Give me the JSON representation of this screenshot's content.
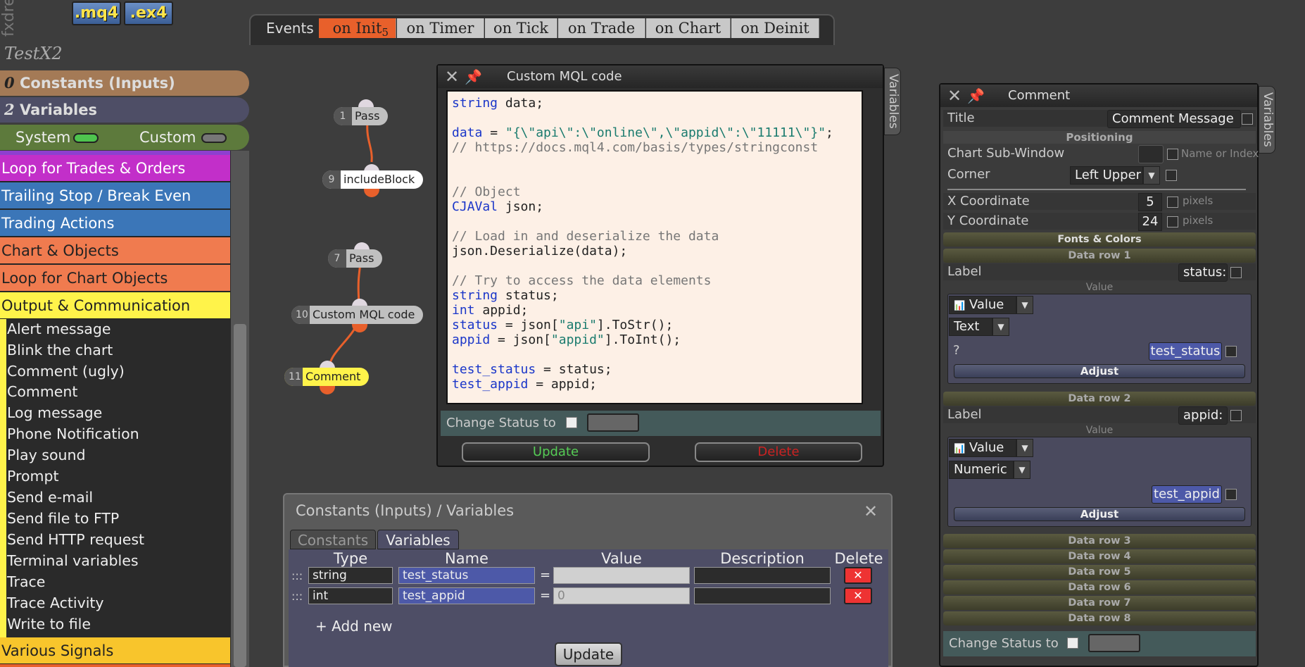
{
  "app": {
    "brand": "fxdre",
    "ext_mq4": ".mq4",
    "ext_ex4": ".ex4",
    "project_name": "TestX2"
  },
  "events": {
    "label": "Events",
    "tabs": [
      {
        "label": "on Init",
        "badge": "5",
        "active": true
      },
      {
        "label": "on Timer"
      },
      {
        "label": "on Tick"
      },
      {
        "label": "on Trade"
      },
      {
        "label": "on Chart"
      },
      {
        "label": "on Deinit"
      }
    ]
  },
  "sidebar": {
    "constants": {
      "count": "0",
      "label": "Constants (Inputs)"
    },
    "variables": {
      "count": "2",
      "label": "Variables"
    },
    "system_label": "System",
    "custom_label": "Custom",
    "groups": [
      {
        "label": "Loop for Trades & Orders",
        "color": "#c22fc9"
      },
      {
        "label": "Trailing Stop / Break Even",
        "color": "#3b76b8"
      },
      {
        "label": "Trading Actions",
        "color": "#3b76b8"
      },
      {
        "label": "Chart & Objects",
        "color": "#f07b4f"
      },
      {
        "label": "Loop for Chart Objects",
        "color": "#f07b4f"
      },
      {
        "label": "Output & Communication",
        "color": "#fff34a"
      }
    ],
    "items": [
      "Alert message",
      "Blink the chart",
      "Comment (ugly)",
      "Comment",
      "Log message",
      "Phone Notification",
      "Play sound",
      "Prompt",
      "Send e-mail",
      "Send file to FTP",
      "Send HTTP request",
      "Terminal variables",
      "Trace",
      "Trace Activity",
      "Write to file"
    ],
    "bottom_group": {
      "label": "Various Signals",
      "color": "#f8c52c"
    }
  },
  "nodes": [
    {
      "num": "1",
      "label": "Pass"
    },
    {
      "num": "9",
      "label": "includeBlock"
    },
    {
      "num": "7",
      "label": "Pass"
    },
    {
      "num": "10",
      "label": "Custom MQL code"
    },
    {
      "num": "11",
      "label": "Comment"
    }
  ],
  "code_window": {
    "title": "Custom MQL code",
    "side_tab": "Variables",
    "code_lines": [
      "string data;",
      "",
      "data = \"{\\\"api\\\":\\\"online\\\",\\\"appid\\\":\\\"11111\\\"}\";",
      "// https://docs.mql4.com/basis/types/stringconst",
      "",
      "",
      "// Object",
      "CJAVal json;",
      "",
      "// Load in and deserialize the data",
      "json.Deserialize(data);",
      "",
      "// Try to access the data elements",
      "string status;",
      "int appid;",
      "status = json[\"api\"].ToStr();",
      "appid = json[\"appid\"].ToInt();",
      "",
      "test_status = status;",
      "test_appid = appid;"
    ],
    "change_status_label": "Change Status to",
    "update_label": "Update",
    "delete_label": "Delete"
  },
  "comment_panel": {
    "title": "Comment",
    "side_tab": "Variables",
    "title_label": "Title",
    "title_value": "Comment Message",
    "positioning": "Positioning",
    "chart_sub_window": "Chart Sub-Window",
    "name_or_index": "Name or Index",
    "corner_label": "Corner",
    "corner_value": "Left Upper",
    "x_label": "X Coordinate",
    "x_value": "5",
    "y_label": "Y Coordinate",
    "y_value": "24",
    "pixels": "pixels",
    "fonts_colors": "Fonts & Colors",
    "rows": [
      {
        "header": "Data row 1",
        "label_text": "Label",
        "label_value": "status:",
        "value_caption": "Value",
        "type_value": "Value",
        "format_value": "Text",
        "extra": "?",
        "var": "test_status",
        "adjust": "Adjust"
      },
      {
        "header": "Data row 2",
        "label_text": "Label",
        "label_value": "appid:",
        "value_caption": "Value",
        "type_value": "Value",
        "format_value": "Numeric",
        "extra": "",
        "var": "test_appid",
        "adjust": "Adjust"
      }
    ],
    "more_rows": [
      "Data row 3",
      "Data row 4",
      "Data row 5",
      "Data row 6",
      "Data row 7",
      "Data row 8"
    ],
    "change_status_label": "Change Status to"
  },
  "vars_panel": {
    "title": "Constants (Inputs) / Variables",
    "tab_constants": "Constants",
    "tab_variables": "Variables",
    "headers": {
      "type": "Type",
      "name": "Name",
      "value": "Value",
      "description": "Description",
      "delete": "Delete"
    },
    "rows": [
      {
        "type": "string",
        "name": "test_status",
        "value": "",
        "description": ""
      },
      {
        "type": "int",
        "name": "test_appid",
        "value": "0",
        "description": ""
      }
    ],
    "add_new": "+ Add new",
    "update_label": "Update"
  }
}
